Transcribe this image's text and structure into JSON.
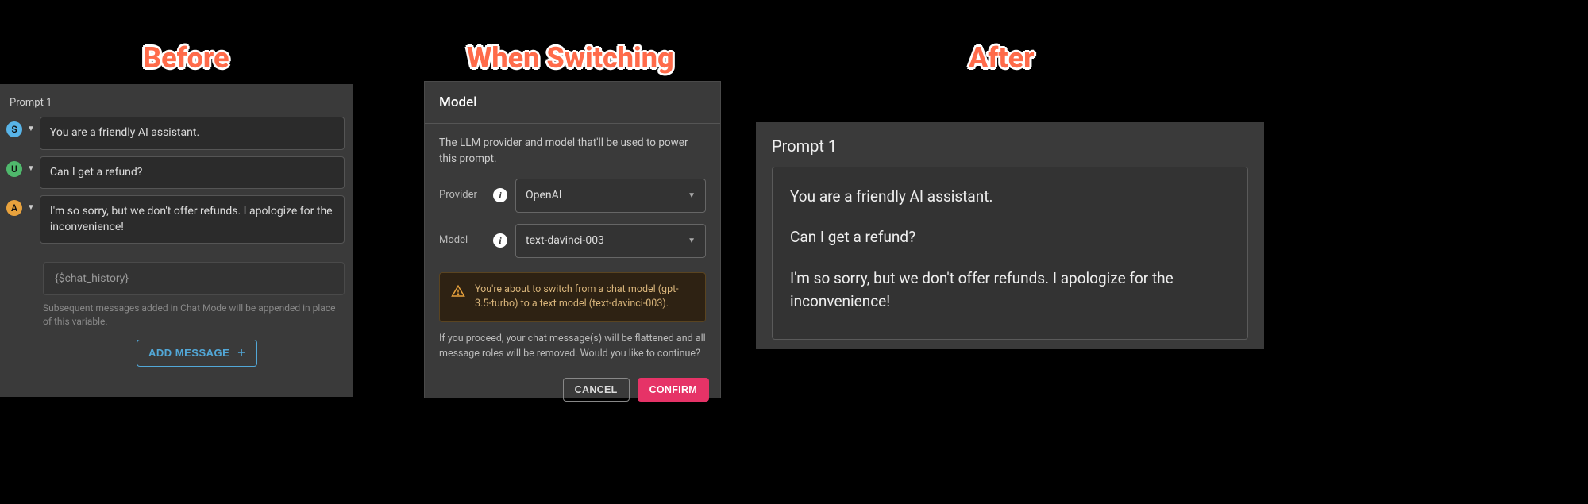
{
  "titles": {
    "before": "Before",
    "switching": "When Switching",
    "after": "After"
  },
  "before": {
    "prompt_label": "Prompt 1",
    "messages": [
      {
        "role": "S",
        "text": "You are a friendly AI assistant."
      },
      {
        "role": "U",
        "text": "Can I get a refund?"
      },
      {
        "role": "A",
        "text": "I'm so sorry, but we don't offer refunds. I apologize for the inconvenience!"
      }
    ],
    "variable_placeholder": "{$chat_history}",
    "helper": "Subsequent messages added in Chat Mode will be appended in place of this variable.",
    "add_button": "ADD MESSAGE"
  },
  "dialog": {
    "title": "Model",
    "description": "The LLM provider and model that'll be used to power this prompt.",
    "provider_label": "Provider",
    "provider_value": "OpenAI",
    "model_label": "Model",
    "model_value": "text-davinci-003",
    "warning": "You're about to switch from a chat model (gpt-3.5-turbo) to a text model (text-davinci-003).",
    "proceed": "If you proceed, your chat message(s) will be flattened and all message roles will be removed. Would you like to continue?",
    "cancel": "CANCEL",
    "confirm": "CONFIRM"
  },
  "after": {
    "prompt_label": "Prompt 1",
    "lines": [
      "You are a friendly AI assistant.",
      "Can I get a refund?",
      "I'm so sorry, but we don't offer refunds. I apologize for the inconvenience!"
    ]
  }
}
